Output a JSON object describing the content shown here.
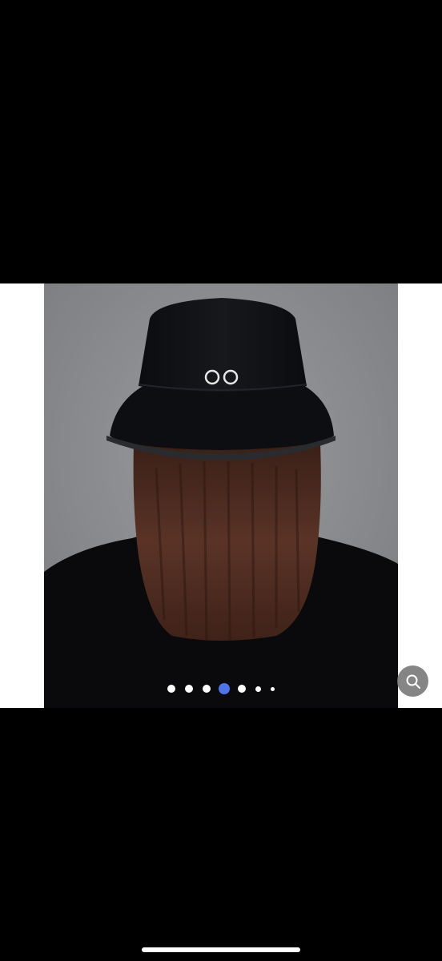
{
  "gallery": {
    "image_alt": "",
    "dots": [
      {
        "active": false
      },
      {
        "active": false
      },
      {
        "active": false
      },
      {
        "active": true
      },
      {
        "active": false
      },
      {
        "active": false
      },
      {
        "active": false
      }
    ],
    "active_color": "#4e74e8",
    "inactive_color": "#ffffff"
  },
  "zoom_button": {
    "icon": "search-icon"
  },
  "colors": {
    "background": "#000000",
    "photo_backdrop": "#8b8c8f",
    "hat": "#101114",
    "hair": "#4a2a1f"
  }
}
